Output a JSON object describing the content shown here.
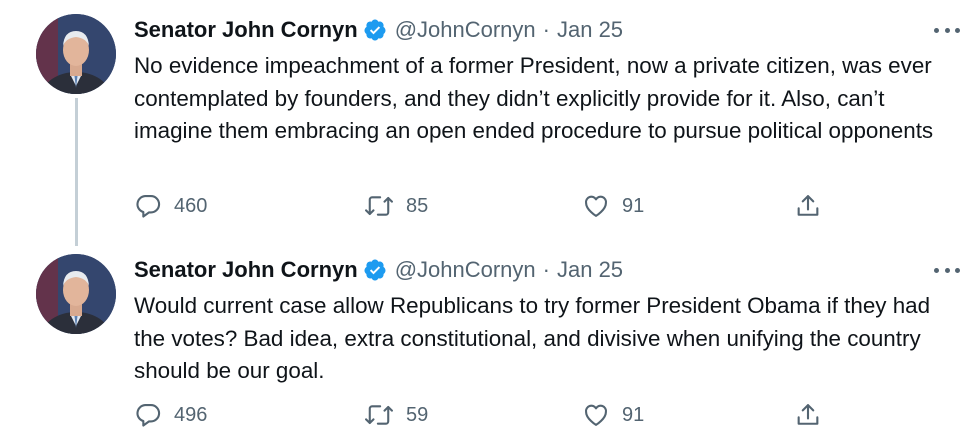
{
  "colors": {
    "text_primary": "#0f1419",
    "text_secondary": "#536471",
    "verified_blue": "#1d9bf0",
    "thread_line": "#c4cfd6"
  },
  "tweets": [
    {
      "author": {
        "name": "Senator John Cornyn",
        "handle": "@JohnCornyn",
        "verified_icon": "verified-badge-icon"
      },
      "separator": "·",
      "date": "Jan 25",
      "text": "No evidence impeachment of a former President, now a private citizen, was ever contemplated by founders, and they didn’t explicitly provide for it. Also, can’t imagine them embracing an open ended procedure to pursue political opponents",
      "actions": {
        "replies": "460",
        "retweets": "85",
        "likes": "91"
      }
    },
    {
      "author": {
        "name": "Senator John Cornyn",
        "handle": "@JohnCornyn",
        "verified_icon": "verified-badge-icon"
      },
      "separator": "·",
      "date": "Jan 25",
      "text": "Would current case allow Republicans to try former President Obama if they had the votes?  Bad idea, extra constitutional, and divisive when unifying the country should be our goal.",
      "actions": {
        "replies": "496",
        "retweets": "59",
        "likes": "91"
      }
    }
  ]
}
